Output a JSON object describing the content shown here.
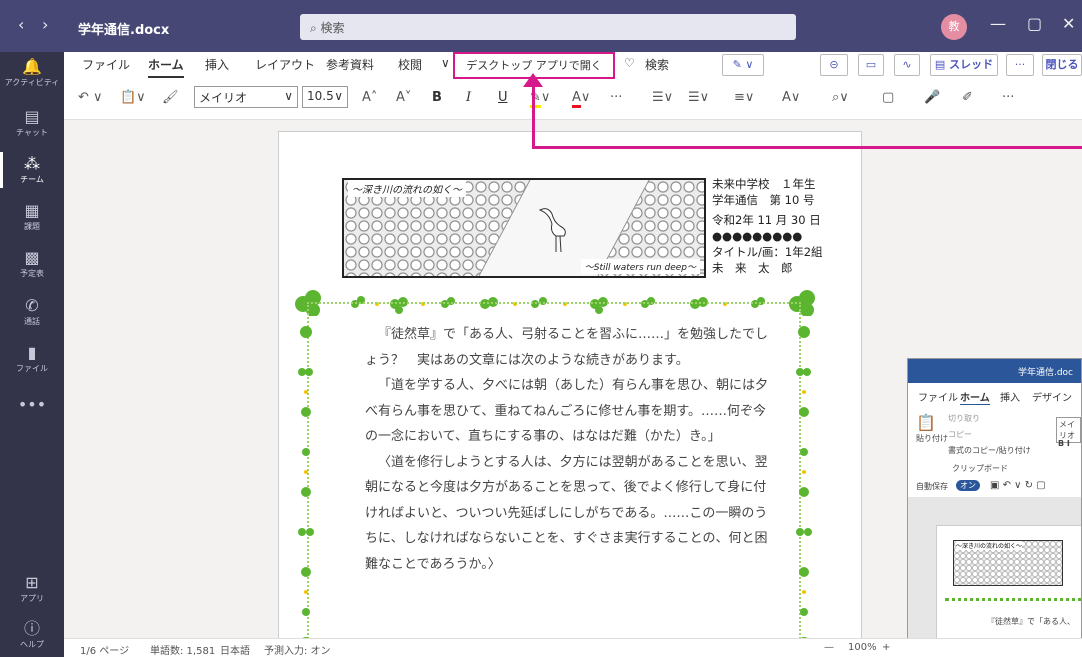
{
  "window": {
    "doc_title": "学年通信.docx",
    "search_placeholder": "検索",
    "avatar_initial": "教",
    "nav_back": "‹",
    "nav_forward": "›",
    "minimize": "—",
    "maximize": "▢",
    "close": "✕"
  },
  "rail": [
    {
      "label": "アクティビティ",
      "icon": "bell-icon",
      "glyph": "🔔"
    },
    {
      "label": "チャット",
      "icon": "chat-icon",
      "glyph": "▤"
    },
    {
      "label": "チーム",
      "icon": "teams-icon",
      "glyph": "⁂"
    },
    {
      "label": "課題",
      "icon": "assignments-icon",
      "glyph": "▦"
    },
    {
      "label": "予定表",
      "icon": "calendar-icon",
      "glyph": "▩"
    },
    {
      "label": "通話",
      "icon": "phone-icon",
      "glyph": "✆"
    },
    {
      "label": "ファイル",
      "icon": "files-icon",
      "glyph": "▮"
    },
    {
      "label": "",
      "icon": "more-icon",
      "glyph": "•••"
    },
    {
      "label": "アプリ",
      "icon": "apps-icon",
      "glyph": "⊞"
    },
    {
      "label": "ヘルプ",
      "icon": "help-icon",
      "glyph": "?"
    }
  ],
  "ribbon": {
    "menu": [
      "ファイル",
      "ホーム",
      "挿入",
      "レイアウト",
      "参考資料",
      "校閲",
      "∨"
    ],
    "open_desktop": "デスクトップ アプリで開く",
    "tell_me": "検索",
    "thread": "スレッド",
    "more": "···",
    "close_doc": "閉じる",
    "font_name": "メイリオ",
    "font_size": "10.5",
    "bold": "B",
    "italic": "I",
    "underline": "U",
    "grow": "A˄",
    "shrink": "A˅",
    "ellipsis": "···"
  },
  "document": {
    "masthead_title": "～深き川の流れの如く～",
    "masthead_sub": "～Still waters run deep～",
    "info_lines": [
      "未来中学校　１年生",
      "学年通信　第 10 号",
      "令和2年 11 月 30 日",
      "●●●●●●●●●",
      "タイトル/画：1年2組",
      "未　来　太　郎"
    ],
    "paragraphs": [
      "『徒然草』で「ある人、弓射ることを習ふに……」を勉強したでしょう？　実はあの文章には次のような続きがあります。",
      "「道を学する人、夕べには朝（あした）有らん事を思ひ、朝には夕べ有らん事を思ひて、重ねてねんごろに修せん事を期す。……何ぞ今の一念において、直ちにする事の、はなはだ難（かた）き。」",
      "〈道を修行しようとする人は、夕方には翌朝があることを思い、翌朝になると今度は夕方があることを思って、後でよく修行して身に付ければよいと、ついつい先延ばしにしがちである。……この一瞬のうちに、しなければならないことを、すぐさま実行することの、何と困難なことであろうか。〉"
    ]
  },
  "status": {
    "page": "1/6 ページ",
    "words": "単語数: 1,581",
    "lang": "日本語",
    "predict": "予測入力: オン",
    "zoom_minus": "—",
    "zoom": "100%",
    "zoom_plus": "+"
  },
  "inset": {
    "title": "学年通信.doc",
    "menu": [
      "ファイル",
      "ホーム",
      "挿入",
      "デザイン"
    ],
    "cut": "切り取り",
    "copy": "コピー",
    "paste": "貼り付け",
    "format_painter": "書式のコピー/貼り付け",
    "font": "メイリオ",
    "clipboard": "クリップボード",
    "autosave": "自動保存",
    "autosave_state": "オン",
    "mini_title": "～深き川の流れの如く～",
    "mini_text": "『徒然草』で「ある人、"
  },
  "colors": {
    "titlebar": "#464775",
    "rail": "#33344a",
    "highlight": "#d6198a",
    "clover": "#5cb531"
  }
}
